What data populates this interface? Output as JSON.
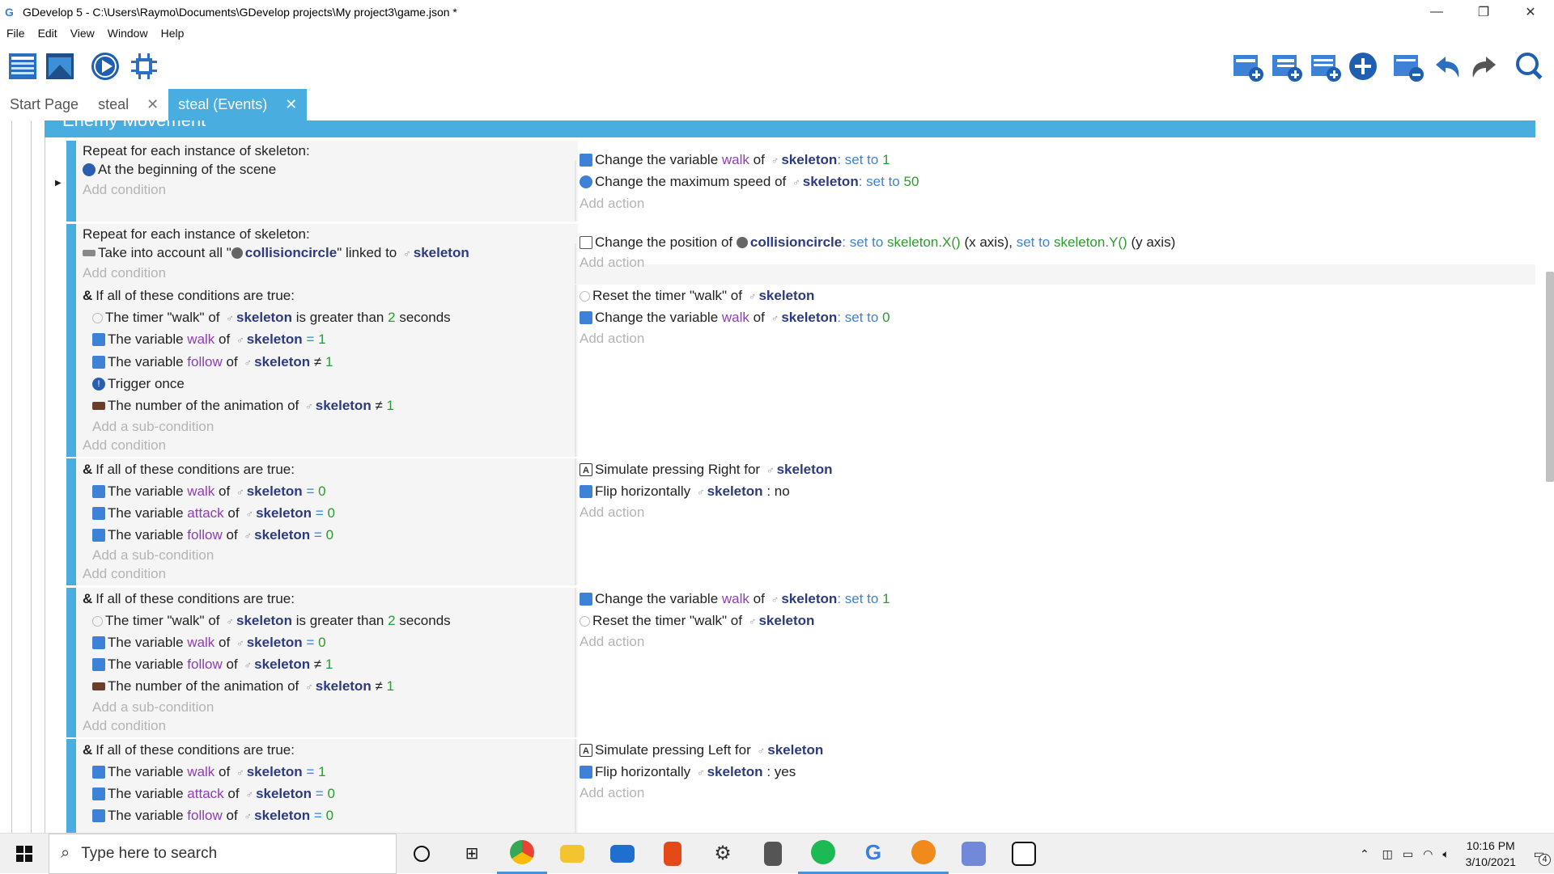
{
  "window": {
    "title": "GDevelop 5 - C:\\Users\\Raymo\\Documents\\GDevelop projects\\My project3\\game.json *",
    "minimize": "—",
    "maximize": "❐",
    "close": "✕"
  },
  "menu": [
    "File",
    "Edit",
    "View",
    "Window",
    "Help"
  ],
  "tabs": [
    {
      "label": "Start Page",
      "closable": false
    },
    {
      "label": "steal",
      "closable": true
    },
    {
      "label": "steal (Events)",
      "closable": true,
      "active": true
    }
  ],
  "tab_close": "✕",
  "group": {
    "title": "Enemy Movement"
  },
  "events": {
    "e1": {
      "head": "Repeat for each instance of skeleton:",
      "cond1": "At the beginning of the scene",
      "add_condition": "Add condition",
      "act1": {
        "pre": "Change the variable",
        "var": "walk",
        "of": "of",
        "obj": "skeleton",
        "op": ": set to",
        "val": "1"
      },
      "act2": {
        "pre": "Change the maximum speed of",
        "obj": "skeleton",
        "op": ": set to",
        "val": "50"
      },
      "add_action": "Add action"
    },
    "e2": {
      "head": "Repeat for each instance of skeleton:",
      "cond1": {
        "pre": "Take into account all \"",
        "obj": "collisioncircle",
        "mid": "\" linked to",
        "obj2": "skeleton"
      },
      "add_condition": "Add condition",
      "act1": {
        "pre": "Change the position of",
        "obj": "collisioncircle",
        "p1": ": set to",
        "v1": "skeleton.X()",
        "a1": "(x axis),",
        "p2": "set to",
        "v2": "skeleton.Y()",
        "a2": "(y axis)"
      },
      "add_action": "Add action"
    },
    "e3": {
      "head": "If all of these conditions are true:",
      "c1": {
        "pre": "The timer \"walk\" of",
        "obj": "skeleton",
        "mid": "is greater than",
        "val": "2",
        "post": "seconds"
      },
      "c2": {
        "pre": "The variable",
        "var": "walk",
        "of": "of",
        "obj": "skeleton",
        "op": "=",
        "val": "1"
      },
      "c3": {
        "pre": "The variable",
        "var": "follow",
        "of": "of",
        "obj": "skeleton",
        "op": "≠",
        "val": "1"
      },
      "c4": "Trigger once",
      "c5": {
        "pre": "The number of the animation of",
        "obj": "skeleton",
        "op": "≠",
        "val": "1"
      },
      "add_sub": "Add a sub-condition",
      "add_condition": "Add condition",
      "a1": {
        "pre": "Reset the timer \"walk\" of",
        "obj": "skeleton"
      },
      "a2": {
        "pre": "Change the variable",
        "var": "walk",
        "of": "of",
        "obj": "skeleton",
        "op": ": set to",
        "val": "0"
      },
      "add_action": "Add action"
    },
    "e4": {
      "head": "If all of these conditions are true:",
      "c1": {
        "pre": "The variable",
        "var": "walk",
        "of": "of",
        "obj": "skeleton",
        "op": "=",
        "val": "0"
      },
      "c2": {
        "pre": "The variable",
        "var": "attack",
        "of": "of",
        "obj": "skeleton",
        "op": "=",
        "val": "0"
      },
      "c3": {
        "pre": "The variable",
        "var": "follow",
        "of": "of",
        "obj": "skeleton",
        "op": "=",
        "val": "0"
      },
      "add_sub": "Add a sub-condition",
      "add_condition": "Add condition",
      "a1": {
        "pre": "Simulate pressing Right for",
        "obj": "skeleton"
      },
      "a2": {
        "pre": "Flip horizontally",
        "obj": "skeleton",
        "post": ": no"
      },
      "add_action": "Add action"
    },
    "e5": {
      "head": "If all of these conditions are true:",
      "c1": {
        "pre": "The timer \"walk\" of",
        "obj": "skeleton",
        "mid": "is greater than",
        "val": "2",
        "post": "seconds"
      },
      "c2": {
        "pre": "The variable",
        "var": "walk",
        "of": "of",
        "obj": "skeleton",
        "op": "=",
        "val": "0"
      },
      "c3": {
        "pre": "The variable",
        "var": "follow",
        "of": "of",
        "obj": "skeleton",
        "op": "≠",
        "val": "1"
      },
      "c4": {
        "pre": "The number of the animation of",
        "obj": "skeleton",
        "op": "≠",
        "val": "1"
      },
      "add_sub": "Add a sub-condition",
      "add_condition": "Add condition",
      "a1": {
        "pre": "Change the variable",
        "var": "walk",
        "of": "of",
        "obj": "skeleton",
        "op": ": set to",
        "val": "1"
      },
      "a2": {
        "pre": "Reset the timer \"walk\" of",
        "obj": "skeleton"
      },
      "add_action": "Add action"
    },
    "e6": {
      "head": "If all of these conditions are true:",
      "c1": {
        "pre": "The variable",
        "var": "walk",
        "of": "of",
        "obj": "skeleton",
        "op": "=",
        "val": "1"
      },
      "c2": {
        "pre": "The variable",
        "var": "attack",
        "of": "of",
        "obj": "skeleton",
        "op": "=",
        "val": "0"
      },
      "c3": {
        "pre": "The variable",
        "var": "follow",
        "of": "of",
        "obj": "skeleton",
        "op": "=",
        "val": "0"
      },
      "a1": {
        "pre": "Simulate pressing Left for",
        "obj": "skeleton"
      },
      "a2": {
        "pre": "Flip horizontally",
        "obj": "skeleton",
        "post": ": yes"
      },
      "add_action": "Add action"
    }
  },
  "taskbar": {
    "search_placeholder": "Type here to search",
    "time": "10:16 PM",
    "date": "3/10/2021",
    "notifications": "4"
  }
}
